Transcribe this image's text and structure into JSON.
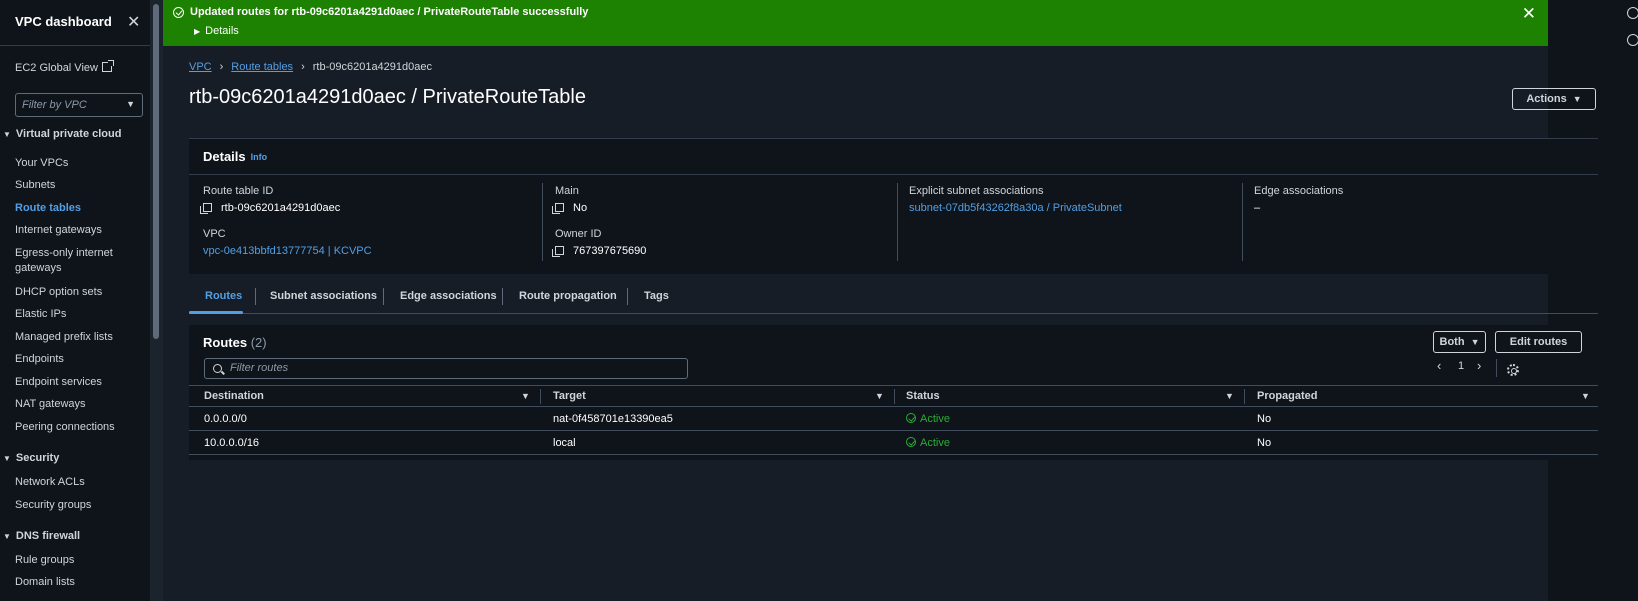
{
  "sidebar": {
    "title": "VPC dashboard",
    "ec2_global_view": "EC2 Global View",
    "filter_placeholder": "Filter by VPC",
    "sections": [
      {
        "label": "Virtual private cloud",
        "items": [
          "Your VPCs",
          "Subnets",
          "Route tables",
          "Internet gateways",
          "Egress-only internet gateways",
          "DHCP option sets",
          "Elastic IPs",
          "Managed prefix lists",
          "Endpoints",
          "Endpoint services",
          "NAT gateways",
          "Peering connections"
        ]
      },
      {
        "label": "Security",
        "items": [
          "Network ACLs",
          "Security groups"
        ]
      },
      {
        "label": "DNS firewall",
        "items": [
          "Rule groups",
          "Domain lists"
        ]
      }
    ],
    "active_item": "Route tables"
  },
  "flash": {
    "message": "Updated routes for rtb-09c6201a4291d0aec / PrivateRouteTable successfully",
    "details_label": "Details",
    "close_glyph": "✕"
  },
  "breadcrumb": {
    "items": [
      "VPC",
      "Route tables",
      "rtb-09c6201a4291d0aec"
    ]
  },
  "page": {
    "title": "rtb-09c6201a4291d0aec / PrivateRouteTable",
    "actions_label": "Actions"
  },
  "details": {
    "heading": "Details",
    "info_label": "Info",
    "route_table_id_label": "Route table ID",
    "route_table_id": "rtb-09c6201a4291d0aec",
    "vpc_label": "VPC",
    "vpc": "vpc-0e413bbfd13777754 | KCVPC",
    "main_label": "Main",
    "main": "No",
    "owner_id_label": "Owner ID",
    "owner_id": "767397675690",
    "explicit_label": "Explicit subnet associations",
    "explicit": "subnet-07db5f43262f8a30a / PrivateSubnet",
    "edge_label": "Edge associations",
    "edge": "–"
  },
  "tabs": [
    "Routes",
    "Subnet associations",
    "Edge associations",
    "Route propagation",
    "Tags"
  ],
  "routes": {
    "title": "Routes",
    "count": "(2)",
    "both_label": "Both",
    "edit_label": "Edit routes",
    "filter_placeholder": "Filter routes",
    "page": "1",
    "columns": [
      "Destination",
      "Target",
      "Status",
      "Propagated"
    ],
    "rows": [
      {
        "destination": "0.0.0.0/0",
        "target": "nat-0f458701e13390ea5",
        "status": "Active",
        "propagated": "No"
      },
      {
        "destination": "10.0.0.0/16",
        "target": "local",
        "status": "Active",
        "propagated": "No"
      }
    ]
  }
}
